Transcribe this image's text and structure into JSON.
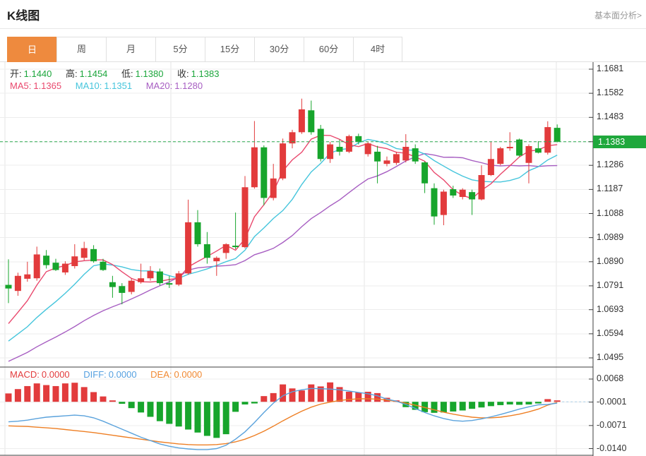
{
  "header": {
    "title": "K线图",
    "link": "基本面分析>"
  },
  "tabs": {
    "items": [
      "日",
      "周",
      "月",
      "5分",
      "15分",
      "30分",
      "60分",
      "4时"
    ],
    "names": [
      "tab-day",
      "tab-week",
      "tab-month",
      "tab-5min",
      "tab-15min",
      "tab-30min",
      "tab-60min",
      "tab-4hour"
    ],
    "active_index": 0
  },
  "readouts": {
    "ohlc": {
      "open_label": "开:",
      "open_value": "1.1440",
      "high_label": "高:",
      "high_value": "1.1454",
      "low_label": "低:",
      "low_value": "1.1380",
      "close_label": "收:",
      "close_value": "1.1383"
    },
    "ma": {
      "ma5_label": "MA5:",
      "ma5_value": "1.1365",
      "ma10_label": "MA10:",
      "ma10_value": "1.1351",
      "ma20_label": "MA20:",
      "ma20_value": "1.1280"
    },
    "macd": {
      "macd_label": "MACD:",
      "macd_value": "0.0000",
      "diff_label": "DIFF:",
      "diff_value": "0.0000",
      "dea_label": "DEA:",
      "dea_value": "0.0000"
    }
  },
  "price_tag": "1.1383",
  "colors": {
    "up": "#e23b3c",
    "down": "#17a52c",
    "ma5": "#e9486d",
    "ma10": "#45c5dc",
    "ma20": "#a75ec2",
    "diff_line": "#5aa2dc",
    "dea_line": "#ee7f24",
    "ohlc_value": "#1ca63c",
    "macd_text": "#e23b3c",
    "diff_text": "#55a0e0",
    "dea_text": "#f08932",
    "tag_bg": "#1fa83c",
    "dashed_price": "#2aa84e",
    "dashed_macd": "#a9cfe8",
    "tab_active_bg": "#ee8a3e",
    "axis_line": "#3f3f3f",
    "grid": "#ededed",
    "vgrid": "#e6e6e6"
  },
  "chart_data": {
    "type": "candlestick",
    "title": "K线图 (日K)",
    "panels": [
      "price",
      "macd"
    ],
    "legend_position": "top-left-overlay",
    "grid": true,
    "price_axis_ticks": [
      "1.1681",
      "1.1582",
      "1.1483",
      "1.1383",
      "1.1286",
      "1.1187",
      "1.1088",
      "1.0989",
      "1.0890",
      "1.0791",
      "1.0693",
      "1.0594",
      "1.0495"
    ],
    "price_axis_range": [
      1.0495,
      1.1681
    ],
    "highlight_price": "1.1383",
    "macd_axis_ticks": [
      "0.0068",
      "-0.0001",
      "-0.0071",
      "-0.0140"
    ],
    "candles_format": [
      "open",
      "high",
      "low",
      "close"
    ],
    "candles": [
      [
        1.0795,
        1.09,
        1.072,
        1.078
      ],
      [
        1.077,
        1.0845,
        1.075,
        1.0832
      ],
      [
        1.082,
        1.089,
        1.0808,
        1.0838
      ],
      [
        1.0822,
        1.0952,
        1.0812,
        1.092
      ],
      [
        1.0915,
        1.0938,
        1.0862,
        1.0876
      ],
      [
        1.0886,
        1.0902,
        1.0852,
        1.0856
      ],
      [
        1.0846,
        1.0892,
        1.0836,
        1.0882
      ],
      [
        1.0872,
        1.0962,
        1.0862,
        1.0912
      ],
      [
        1.0906,
        1.0972,
        1.0896,
        1.0946
      ],
      [
        1.0942,
        1.0958,
        1.0886,
        1.0892
      ],
      [
        1.089,
        1.0902,
        1.0852,
        1.0856
      ],
      [
        1.0806,
        1.0832,
        1.0742,
        1.0786
      ],
      [
        1.079,
        1.0802,
        1.0715,
        1.0762
      ],
      [
        1.0766,
        1.0822,
        1.0756,
        1.0812
      ],
      [
        1.0806,
        1.0882,
        1.08,
        1.0822
      ],
      [
        1.0822,
        1.0872,
        1.0812,
        1.0852
      ],
      [
        1.085,
        1.0862,
        1.0792,
        1.0802
      ],
      [
        1.0802,
        1.0832,
        1.0782,
        1.0796
      ],
      [
        1.0796,
        1.0852,
        1.079,
        1.0842
      ],
      [
        1.0842,
        1.1145,
        1.0836,
        1.1052
      ],
      [
        1.1052,
        1.1102,
        1.0952,
        1.0962
      ],
      [
        1.0962,
        1.1012,
        1.0882,
        1.0906
      ],
      [
        1.0892,
        1.0912,
        1.0832,
        1.0906
      ],
      [
        1.0926,
        1.0966,
        1.0902,
        1.0962
      ],
      [
        1.0956,
        1.1092,
        1.0942,
        1.095
      ],
      [
        1.095,
        1.1242,
        1.0945,
        1.1196
      ],
      [
        1.1196,
        1.1468,
        1.119,
        1.136
      ],
      [
        1.136,
        1.1368,
        1.1122,
        1.1152
      ],
      [
        1.1152,
        1.1292,
        1.1142,
        1.1232
      ],
      [
        1.1232,
        1.1396,
        1.1225,
        1.1376
      ],
      [
        1.1376,
        1.1432,
        1.1356,
        1.1422
      ],
      [
        1.1422,
        1.156,
        1.1415,
        1.1516
      ],
      [
        1.1512,
        1.1552,
        1.1412,
        1.1422
      ],
      [
        1.1436,
        1.1452,
        1.1302,
        1.1312
      ],
      [
        1.1312,
        1.1382,
        1.1296,
        1.1372
      ],
      [
        1.1362,
        1.1392,
        1.1326,
        1.1342
      ],
      [
        1.1342,
        1.1412,
        1.1336,
        1.1406
      ],
      [
        1.1406,
        1.1416,
        1.1372,
        1.1382
      ],
      [
        1.1332,
        1.1382,
        1.1322,
        1.1376
      ],
      [
        1.1342,
        1.1366,
        1.1212,
        1.1302
      ],
      [
        1.1292,
        1.1322,
        1.1282,
        1.1306
      ],
      [
        1.1296,
        1.1342,
        1.1288,
        1.1332
      ],
      [
        1.1306,
        1.1414,
        1.1298,
        1.1362
      ],
      [
        1.1356,
        1.1372,
        1.1292,
        1.1302
      ],
      [
        1.1298,
        1.1302,
        1.1172,
        1.1212
      ],
      [
        1.1192,
        1.1212,
        1.1042,
        1.1076
      ],
      [
        1.1082,
        1.1186,
        1.104,
        1.1178
      ],
      [
        1.1188,
        1.1202,
        1.1152,
        1.1162
      ],
      [
        1.1156,
        1.1192,
        1.1146,
        1.1186
      ],
      [
        1.1176,
        1.1186,
        1.1082,
        1.1146
      ],
      [
        1.1146,
        1.1286,
        1.1142,
        1.1246
      ],
      [
        1.1246,
        1.1382,
        1.1242,
        1.1312
      ],
      [
        1.1292,
        1.1362,
        1.1286,
        1.1356
      ],
      [
        1.1356,
        1.1422,
        1.1346,
        1.1362
      ],
      [
        1.1392,
        1.1396,
        1.1322,
        1.1326
      ],
      [
        1.1296,
        1.1372,
        1.1212,
        1.1365
      ],
      [
        1.1356,
        1.1385,
        1.1335,
        1.1338
      ],
      [
        1.1338,
        1.1467,
        1.133,
        1.1443
      ],
      [
        1.144,
        1.1454,
        1.138,
        1.1383
      ]
    ],
    "ma_windows": {
      "ma5": 5,
      "ma10": 10,
      "ma20": 20
    },
    "ma_left_edge_values": {
      "ma5": 1.06,
      "ma10": 1.054,
      "ma20": 1.0465
    },
    "ma_last_values": {
      "ma5": 1.1365,
      "ma10": 1.1351,
      "ma20": 1.128
    },
    "macd_histogram": [
      0.0025,
      0.0038,
      0.0047,
      0.0055,
      0.005,
      0.0047,
      0.0055,
      0.0057,
      0.0044,
      0.0029,
      0.0016,
      0.0004,
      -0.0006,
      -0.0019,
      -0.0032,
      -0.0045,
      -0.0058,
      -0.0066,
      -0.0074,
      -0.0083,
      -0.0092,
      -0.0102,
      -0.0108,
      -0.0097,
      -0.003,
      -0.0008,
      -0.0005,
      0.0017,
      0.0026,
      0.0052,
      0.004,
      0.0034,
      0.0052,
      0.0046,
      0.0058,
      0.0044,
      0.003,
      0.0028,
      0.003,
      0.0026,
      0.0012,
      0.0004,
      -0.0016,
      -0.0024,
      -0.0031,
      -0.0033,
      -0.0032,
      -0.0029,
      -0.0026,
      -0.0021,
      -0.0017,
      -0.0013,
      -0.001,
      -0.0008,
      -0.0009,
      -0.0008,
      -0.0005,
      0.0008,
      0.0004
    ],
    "diff_line": [
      -0.006,
      -0.0058,
      -0.0055,
      -0.005,
      -0.0046,
      -0.0044,
      -0.0042,
      -0.004,
      -0.0042,
      -0.0048,
      -0.0058,
      -0.007,
      -0.0082,
      -0.0094,
      -0.0106,
      -0.0116,
      -0.0126,
      -0.0133,
      -0.0138,
      -0.0141,
      -0.0143,
      -0.0143,
      -0.014,
      -0.013,
      -0.0112,
      -0.009,
      -0.0062,
      -0.0032,
      -0.0004,
      0.0018,
      0.003,
      0.0036,
      0.004,
      0.0039,
      0.0038,
      0.0036,
      0.0032,
      0.0028,
      0.0024,
      0.0018,
      0.0008,
      0.0002,
      -0.0008,
      -0.002,
      -0.0032,
      -0.0042,
      -0.005,
      -0.0056,
      -0.0058,
      -0.0056,
      -0.0051,
      -0.0045,
      -0.0038,
      -0.003,
      -0.0022,
      -0.0015,
      -0.0009,
      -0.0008,
      -0.0004
    ],
    "dea_line": [
      -0.0072,
      -0.0073,
      -0.0074,
      -0.0076,
      -0.0078,
      -0.008,
      -0.0083,
      -0.0086,
      -0.0089,
      -0.0092,
      -0.0096,
      -0.01,
      -0.0104,
      -0.0108,
      -0.0112,
      -0.0116,
      -0.012,
      -0.0123,
      -0.0126,
      -0.0128,
      -0.0129,
      -0.0129,
      -0.0128,
      -0.0125,
      -0.012,
      -0.0112,
      -0.0101,
      -0.0088,
      -0.0073,
      -0.0057,
      -0.0042,
      -0.0028,
      -0.0016,
      -0.0007,
      -0.0001,
      0.0004,
      0.0007,
      0.0009,
      0.0009,
      0.0008,
      0.0005,
      0.0001,
      -0.0004,
      -0.001,
      -0.0017,
      -0.0024,
      -0.0031,
      -0.0037,
      -0.0042,
      -0.0046,
      -0.0048,
      -0.0048,
      -0.0046,
      -0.0042,
      -0.0037,
      -0.003,
      -0.0022,
      -0.001,
      -0.0002
    ]
  }
}
